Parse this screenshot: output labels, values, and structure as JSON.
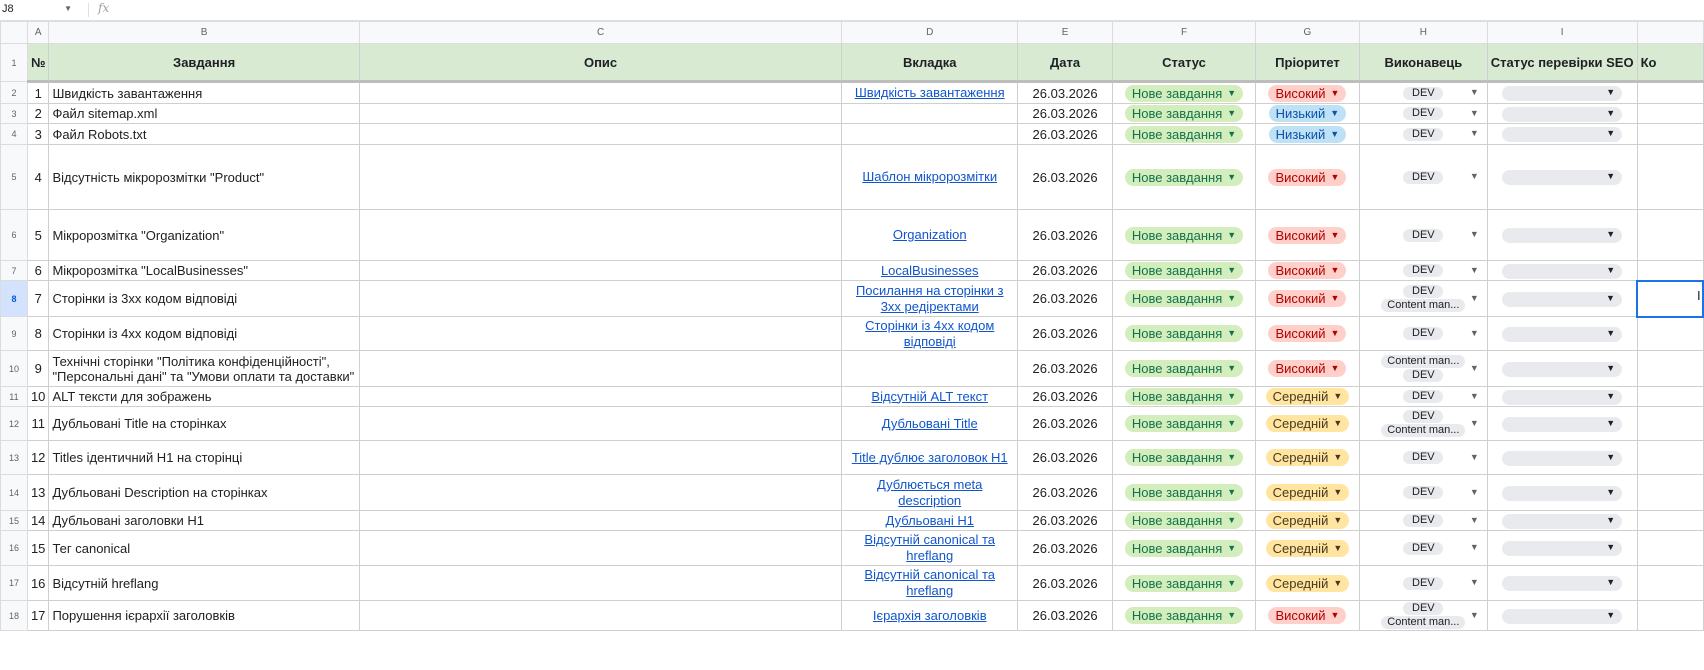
{
  "formula_bar": {
    "cell_ref": "J8",
    "fx_icon": "fx",
    "value": ""
  },
  "columns": [
    "",
    "A",
    "B",
    "C",
    "D",
    "E",
    "F",
    "G",
    "H",
    "I",
    ""
  ],
  "header": {
    "row_num": "1",
    "labels": [
      "№",
      "Завдання",
      "Опис",
      "Вкладка",
      "Дата",
      "Статус",
      "Пріоритет",
      "Виконавець",
      "Статус перевірки SEO",
      "Ко"
    ]
  },
  "rows": [
    {
      "row": "2",
      "num": "1",
      "task": "Швидкість завантаження",
      "tab": "Швидкість завантаження",
      "date": "26.03.2026",
      "status": "Нове завдання",
      "priority": "Високий",
      "pclass": "pr-high",
      "exec": [
        "DEV"
      ]
    },
    {
      "row": "3",
      "num": "2",
      "task": "Файл sitemap.xml",
      "tab": "",
      "date": "26.03.2026",
      "status": "Нове завдання",
      "priority": "Низький",
      "pclass": "pr-low",
      "exec": [
        "DEV"
      ]
    },
    {
      "row": "4",
      "num": "3",
      "task": "Файл Robots.txt",
      "tab": "",
      "date": "26.03.2026",
      "status": "Нове завдання",
      "priority": "Низький",
      "pclass": "pr-low",
      "exec": [
        "DEV"
      ]
    },
    {
      "row": "5",
      "num": "4",
      "task": "Відсутність мікророзмітки \"Product\"",
      "tab": "Шаблон мікророзмітки",
      "date": "26.03.2026",
      "status": "Нове завдання",
      "priority": "Високий",
      "pclass": "pr-high",
      "exec": [
        "DEV"
      ]
    },
    {
      "row": "6",
      "num": "5",
      "task": "Мікророзмітка \"Organization\"",
      "tab": "Organization",
      "date": "26.03.2026",
      "status": "Нове завдання",
      "priority": "Високий",
      "pclass": "pr-high",
      "exec": [
        "DEV"
      ]
    },
    {
      "row": "7",
      "num": "6",
      "task": "Мікророзмітка \"LocalBusinesses\"",
      "tab": "LocalBusinesses",
      "date": "26.03.2026",
      "status": "Нове завдання",
      "priority": "Високий",
      "pclass": "pr-high",
      "exec": [
        "DEV"
      ]
    },
    {
      "row": "8",
      "num": "7",
      "task": "Сторінки із 3хх кодом відповіді",
      "tab": "Посилання на сторінки з 3хх редіректами",
      "date": "26.03.2026",
      "status": "Нове завдання",
      "priority": "Високий",
      "pclass": "pr-high",
      "exec": [
        "DEV",
        "Content man..."
      ]
    },
    {
      "row": "9",
      "num": "8",
      "task": "Сторінки із 4хх кодом відповіді",
      "tab": "Сторінки із 4хх кодом відповіді",
      "date": "26.03.2026",
      "status": "Нове завдання",
      "priority": "Високий",
      "pclass": "pr-high",
      "exec": [
        "DEV"
      ]
    },
    {
      "row": "10",
      "num": "9",
      "task": "Технічні сторінки \"Політика конфіденційності\", \"Персональні дані\" та \"Умови оплати та доставки\"",
      "tab": "",
      "date": "26.03.2026",
      "status": "Нове завдання",
      "priority": "Високий",
      "pclass": "pr-high",
      "exec": [
        "Content man...",
        "DEV"
      ]
    },
    {
      "row": "11",
      "num": "10",
      "task": "ALT тексти для зображень",
      "tab": "Відсутній ALT текст",
      "date": "26.03.2026",
      "status": "Нове завдання",
      "priority": "Середній",
      "pclass": "pr-mid",
      "exec": [
        "DEV"
      ]
    },
    {
      "row": "12",
      "num": "11",
      "task": "Дубльовані Title на сторінках",
      "tab": "Дубльовані Title",
      "date": "26.03.2026",
      "status": "Нове завдання",
      "priority": "Середній",
      "pclass": "pr-mid",
      "exec": [
        "DEV",
        "Content man..."
      ]
    },
    {
      "row": "13",
      "num": "12",
      "task": "Titles ідентичний H1 на сторінці",
      "tab": "Title дублює заголовок H1",
      "date": "26.03.2026",
      "status": "Нове завдання",
      "priority": "Середній",
      "pclass": "pr-mid",
      "exec": [
        "DEV"
      ]
    },
    {
      "row": "14",
      "num": "13",
      "task": "Дубльовані Description на сторінках",
      "tab": "Дублюється meta description",
      "date": "26.03.2026",
      "status": "Нове завдання",
      "priority": "Середній",
      "pclass": "pr-mid",
      "exec": [
        "DEV"
      ]
    },
    {
      "row": "15",
      "num": "14",
      "task": "Дубльовані заголовки H1",
      "tab": "Дубльовані H1",
      "date": "26.03.2026",
      "status": "Нове завдання",
      "priority": "Середній",
      "pclass": "pr-mid",
      "exec": [
        "DEV"
      ]
    },
    {
      "row": "16",
      "num": "15",
      "task": "Тег canonical",
      "tab": "Відсутній canonical та hreflang",
      "date": "26.03.2026",
      "status": "Нове завдання",
      "priority": "Середній",
      "pclass": "pr-mid",
      "exec": [
        "DEV"
      ]
    },
    {
      "row": "17",
      "num": "16",
      "task": "Відсутній hreflang",
      "tab": "Відсутній canonical та hreflang",
      "date": "26.03.2026",
      "status": "Нове завдання",
      "priority": "Середній",
      "pclass": "pr-mid",
      "exec": [
        "DEV"
      ]
    },
    {
      "row": "18",
      "num": "17",
      "task": "Порушення ієрархії заголовків",
      "tab": "Ієрархія заголовків",
      "date": "26.03.2026",
      "status": "Нове завдання",
      "priority": "Високий",
      "pclass": "pr-high",
      "exec": [
        "DEV",
        "Content man..."
      ]
    }
  ],
  "selected_row": "8"
}
